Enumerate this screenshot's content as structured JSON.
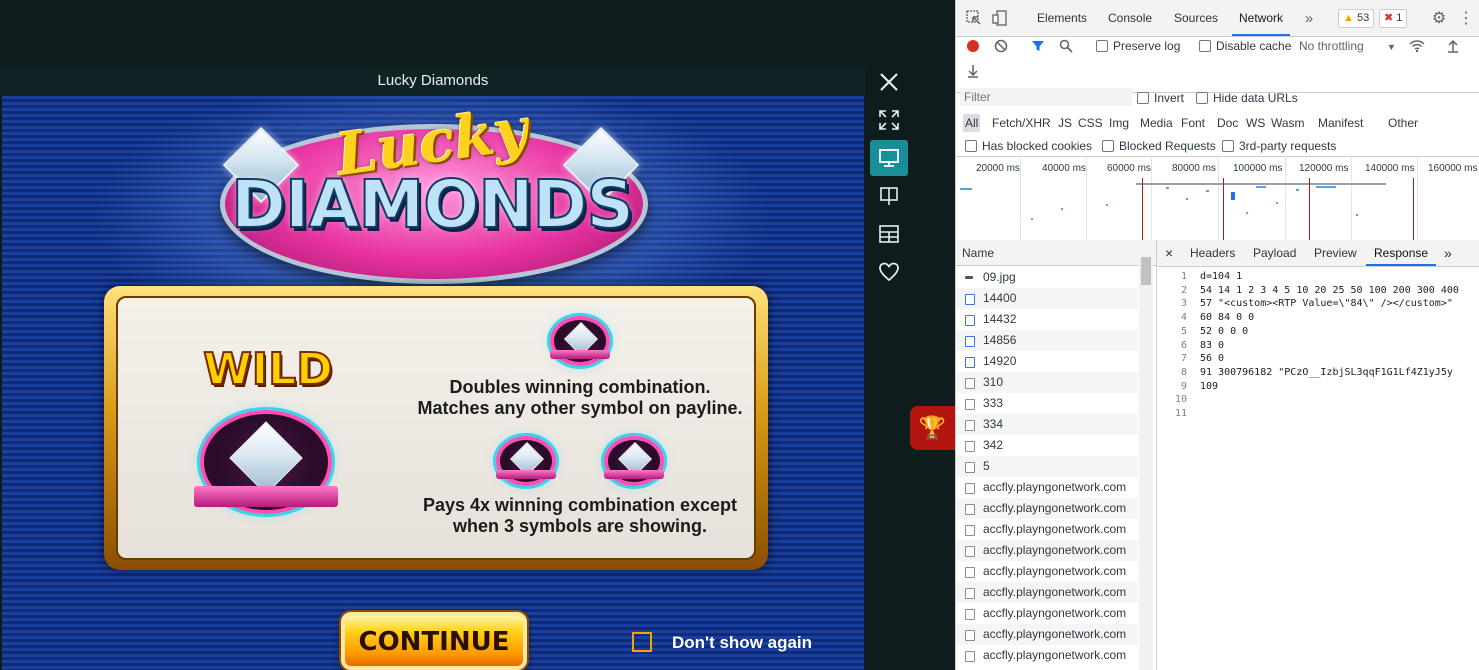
{
  "game": {
    "window_title": "Lucky Diamonds",
    "logo_top": "Lucky",
    "logo_bottom": "DIAMONDS",
    "wild_label": "WILD",
    "desc1_line1": "Doubles winning combination.",
    "desc1_line2": "Matches any other symbol on payline.",
    "desc2_line1": "Pays 4x winning combination except",
    "desc2_line2": "when 3 symbols are showing.",
    "continue_label": "CONTINUE",
    "dont_show_label": "Don't show again",
    "icons": [
      "close-icon",
      "fullscreen-icon",
      "desktop-icon",
      "book-icon",
      "layout-icon",
      "heart-icon",
      "trophy-icon"
    ]
  },
  "devtools": {
    "tabs": [
      "Elements",
      "Console",
      "Sources",
      "Network"
    ],
    "active_tab": "Network",
    "warnings_count": "53",
    "errors_count": "1",
    "toolbar": {
      "preserve_log": "Preserve log",
      "disable_cache": "Disable cache",
      "throttling": "No throttling"
    },
    "filter_placeholder": "Filter",
    "invert": "Invert",
    "hide_data_urls": "Hide data URLs",
    "types": [
      "All",
      "Fetch/XHR",
      "JS",
      "CSS",
      "Img",
      "Media",
      "Font",
      "Doc",
      "WS",
      "Wasm",
      "Manifest",
      "Other"
    ],
    "has_blocked_cookies": "Has blocked cookies",
    "blocked_requests": "Blocked Requests",
    "third_party": "3rd-party requests",
    "timeline_ticks": [
      "20000 ms",
      "40000 ms",
      "60000 ms",
      "80000 ms",
      "100000 ms",
      "120000 ms",
      "140000 ms",
      "160000 ms"
    ],
    "name_header": "Name",
    "requests": [
      "09.jpg",
      "14400",
      "14432",
      "14856",
      "14920",
      "310",
      "333",
      "334",
      "342",
      "5",
      "accfly.playngonetwork.com",
      "accfly.playngonetwork.com",
      "accfly.playngonetwork.com",
      "accfly.playngonetwork.com",
      "accfly.playngonetwork.com",
      "accfly.playngonetwork.com",
      "accfly.playngonetwork.com",
      "accfly.playngonetwork.com",
      "accfly.playngonetwork.com"
    ],
    "response_tabs": [
      "Headers",
      "Payload",
      "Preview",
      "Response"
    ],
    "active_response_tab": "Response",
    "response_lines": [
      "d=104 1",
      "54 14 1 2 3 4 5 10 20 25 50 100 200 300 400",
      "57 \"<custom><RTP Value=\\\"84\\\" /></custom>\"",
      "60 84 0 0",
      "52 0 0 0",
      "83 0",
      "56 0",
      "91 300796182 \"PCzO__IzbjSL3qqF1G1Lf4Z1yJ5y",
      "109",
      "",
      ""
    ],
    "colors": {
      "accent": "#1a73e8",
      "record": "#d93025"
    }
  }
}
